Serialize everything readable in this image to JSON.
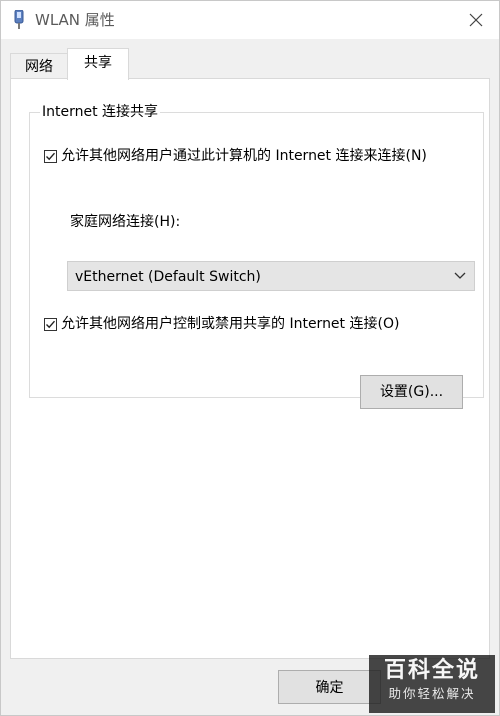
{
  "window": {
    "title": "WLAN 属性",
    "close_icon": "close-icon"
  },
  "tabs": [
    {
      "label": "网络",
      "active": false
    },
    {
      "label": "共享",
      "active": true
    }
  ],
  "group": {
    "title": "Internet 连接共享",
    "allow_share": {
      "label": "允许其他网络用户通过此计算机的 Internet 连接来连接(N)",
      "checked": true
    },
    "home_network": {
      "label": "家庭网络连接(H):",
      "selected": "vEthernet (Default Switch)"
    },
    "allow_control": {
      "label": "允许其他网络用户控制或禁用共享的 Internet 连接(O)",
      "checked": true
    },
    "settings_button": "设置(G)..."
  },
  "footer": {
    "ok_label": "确定"
  },
  "watermark": {
    "top": "百科全说",
    "bottom": "助你轻松解决"
  }
}
